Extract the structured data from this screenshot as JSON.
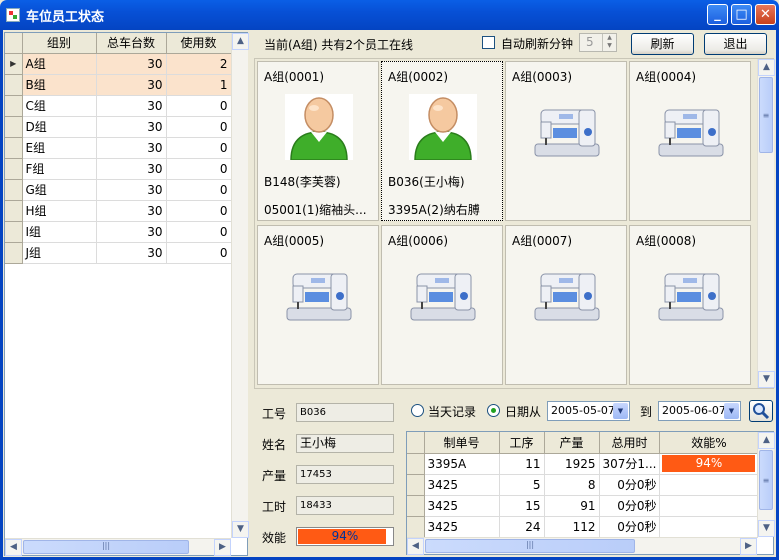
{
  "window": {
    "title": "车位员工状态"
  },
  "group_grid": {
    "headers": [
      "组别",
      "总车台数",
      "使用数"
    ],
    "rows": [
      {
        "group": "A组",
        "total": "30",
        "used": "2"
      },
      {
        "group": "B组",
        "total": "30",
        "used": "1"
      },
      {
        "group": "C组",
        "total": "30",
        "used": "0"
      },
      {
        "group": "D组",
        "total": "30",
        "used": "0"
      },
      {
        "group": "E组",
        "total": "30",
        "used": "0"
      },
      {
        "group": "F组",
        "total": "30",
        "used": "0"
      },
      {
        "group": "G组",
        "total": "30",
        "used": "0"
      },
      {
        "group": "H组",
        "total": "30",
        "used": "0"
      },
      {
        "group": "I组",
        "total": "30",
        "used": "0"
      },
      {
        "group": "J组",
        "total": "30",
        "used": "0"
      }
    ]
  },
  "toolbar": {
    "online_text": "当前(A组) 共有2个员工在线",
    "auto_refresh_label": "自动刷新分钟",
    "auto_refresh_minutes": "5",
    "refresh_label": "刷新",
    "exit_label": "退出"
  },
  "cards": [
    {
      "title": "A组(0001)",
      "type": "user",
      "line1": "B148(李芙蓉)",
      "line2": "05001(1)缩袖头..."
    },
    {
      "title": "A组(0002)",
      "type": "user",
      "line1": "B036(王小梅)",
      "line2": "3395A(2)纳右膊"
    },
    {
      "title": "A组(0003)",
      "type": "machine",
      "line1": "",
      "line2": ""
    },
    {
      "title": "A组(0004)",
      "type": "machine",
      "line1": "",
      "line2": ""
    },
    {
      "title": "A组(0005)",
      "type": "machine",
      "line1": "",
      "line2": ""
    },
    {
      "title": "A组(0006)",
      "type": "machine",
      "line1": "",
      "line2": ""
    },
    {
      "title": "A组(0007)",
      "type": "machine",
      "line1": "",
      "line2": ""
    },
    {
      "title": "A组(0008)",
      "type": "machine",
      "line1": "",
      "line2": ""
    }
  ],
  "details": {
    "emp_id_label": "工号",
    "emp_id": "B036",
    "name_label": "姓名",
    "name": "王小梅",
    "output_label": "产量",
    "output": "17453",
    "hours_label": "工时",
    "hours": "18433",
    "efficiency_label": "效能",
    "efficiency": "94%",
    "efficiency_fraction": 0.94
  },
  "filter": {
    "today_label": "当天记录",
    "date_from_label": "日期从",
    "date_from": "2005-05-07",
    "to_label": "到",
    "date_to": "2005-06-07",
    "selected": "date_range"
  },
  "records": {
    "headers": [
      "制单号",
      "工序",
      "产量",
      "总用时",
      "效能%"
    ],
    "rows": [
      {
        "order": "3395A",
        "process": "11",
        "qty": "1925",
        "time": "307分1...",
        "eff": "94%"
      },
      {
        "order": "3425",
        "process": "5",
        "qty": "8",
        "time": "0分0秒",
        "eff": ""
      },
      {
        "order": "3425",
        "process": "15",
        "qty": "91",
        "time": "0分0秒",
        "eff": ""
      },
      {
        "order": "3425",
        "process": "24",
        "qty": "112",
        "time": "0分0秒",
        "eff": ""
      }
    ]
  },
  "colors": {
    "accent_bar": "#ff5a14",
    "title_bar": "#0a5fe6",
    "row_highlight": "#fbe3cc"
  }
}
